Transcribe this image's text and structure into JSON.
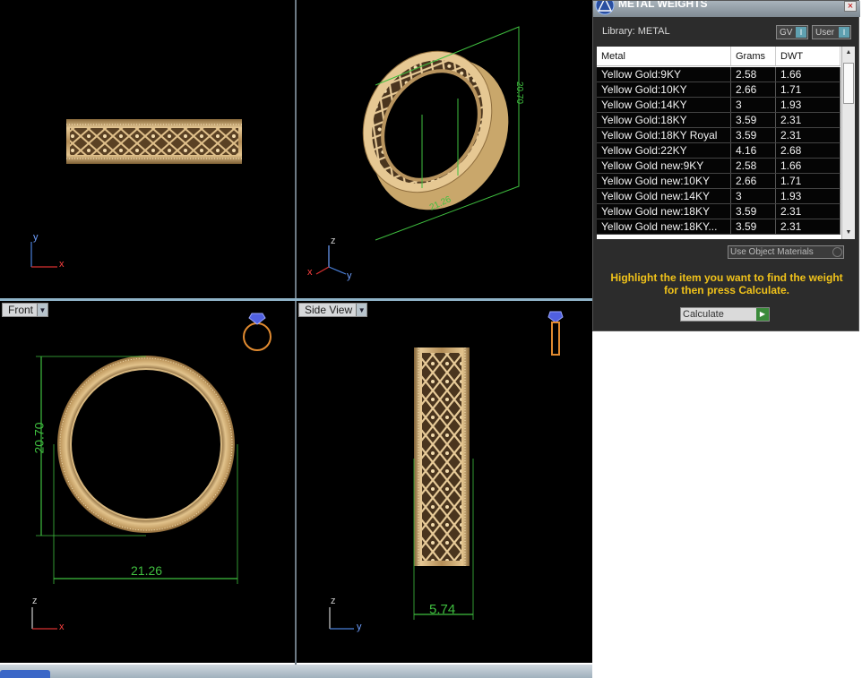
{
  "viewports": {
    "front_label": "Front",
    "side_label": "Side View",
    "dims": {
      "perspective_height": "20.70",
      "perspective_depth": "21.26",
      "front_height": "20.70",
      "front_width": "21.26",
      "side_width": "5.74"
    },
    "axes": {
      "x": "x",
      "y": "y",
      "z": "z"
    }
  },
  "panel": {
    "title": "METAL WEIGHTS",
    "close_label": "×",
    "library_label": "Library: METAL",
    "gv_label": "GV",
    "user_label": "User",
    "toggle_indicator": "I",
    "columns": [
      "Metal",
      "Grams",
      "DWT"
    ],
    "rows": [
      [
        "Yellow Gold:9KY",
        "2.58",
        "1.66"
      ],
      [
        "Yellow Gold:10KY",
        "2.66",
        "1.71"
      ],
      [
        "Yellow Gold:14KY",
        "3",
        "1.93"
      ],
      [
        "Yellow Gold:18KY",
        "3.59",
        "2.31"
      ],
      [
        "Yellow Gold:18KY Royal",
        "3.59",
        "2.31"
      ],
      [
        "Yellow Gold:22KY",
        "4.16",
        "2.68"
      ],
      [
        "Yellow Gold new:9KY",
        "2.58",
        "1.66"
      ],
      [
        "Yellow Gold new:10KY",
        "2.66",
        "1.71"
      ],
      [
        "Yellow Gold new:14KY",
        "3",
        "1.93"
      ],
      [
        "Yellow Gold new:18KY",
        "3.59",
        "2.31"
      ],
      [
        "Yellow Gold new:18KY...",
        "3.59",
        "2.31"
      ]
    ],
    "use_object_materials": "Use Object Materials",
    "hint": "Highlight the item you want to find the weight for then press Calculate.",
    "calculate_label": "Calculate"
  },
  "colors": {
    "gold": "#c9a76b",
    "dimension": "#3fbf3f",
    "hint": "#f0c21a",
    "viewport_bg": "#000000"
  }
}
